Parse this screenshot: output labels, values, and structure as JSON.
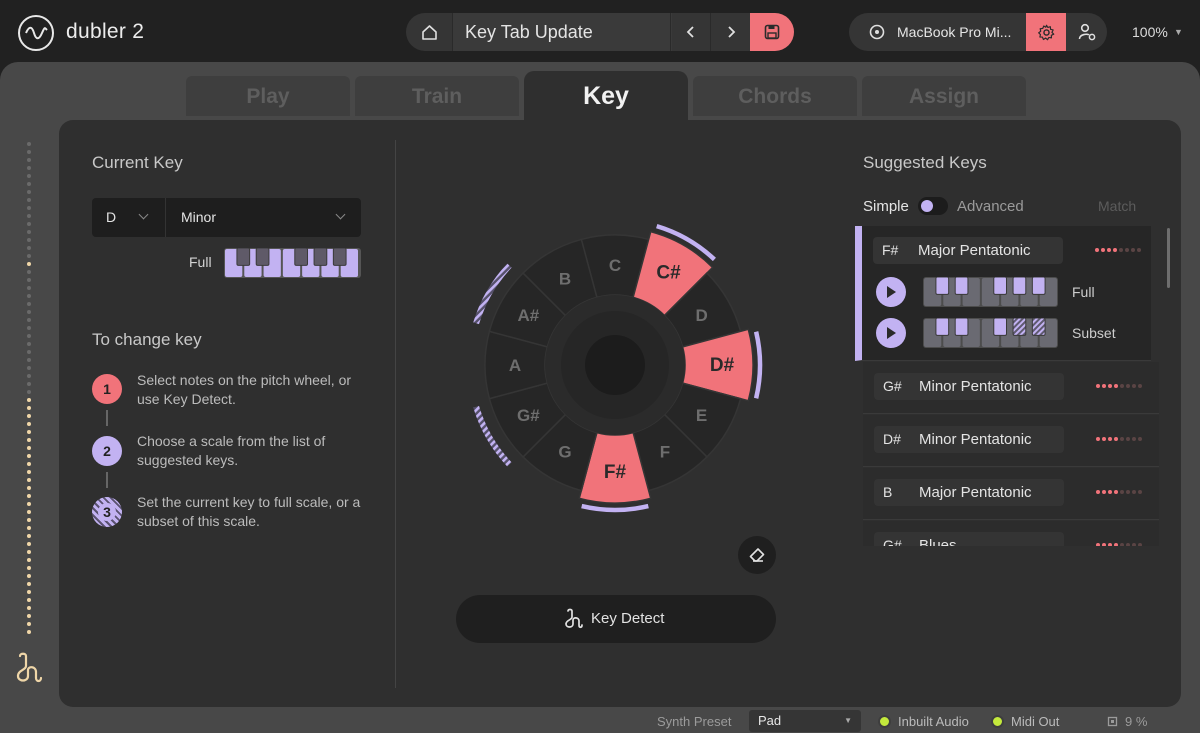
{
  "app": {
    "title": "dubler 2"
  },
  "toolbar": {
    "preset_name": "Key Tab Update",
    "device_name": "MacBook Pro Mi...",
    "zoom": "100%"
  },
  "tabs": [
    {
      "label": "Play"
    },
    {
      "label": "Train"
    },
    {
      "label": "Key",
      "active": true
    },
    {
      "label": "Chords"
    },
    {
      "label": "Assign"
    }
  ],
  "current_key": {
    "title": "Current Key",
    "root": "D",
    "scale": "Minor",
    "range_label": "Full"
  },
  "instructions": {
    "title": "To change key",
    "steps": [
      {
        "num": "1",
        "text": "Select notes on the pitch wheel, or use Key Detect."
      },
      {
        "num": "2",
        "text": "Choose a scale from the list of suggested keys."
      },
      {
        "num": "3",
        "text": "Set the current key to full scale, or a subset of this scale."
      }
    ]
  },
  "pitch_wheel": {
    "notes": [
      "C",
      "C#",
      "D",
      "D#",
      "E",
      "F",
      "F#",
      "G",
      "G#",
      "A",
      "A#",
      "B"
    ],
    "selected": [
      "C#",
      "D#",
      "F#"
    ],
    "arc_solid": [
      "C#",
      "D#",
      "F#"
    ],
    "arc_hatched": [
      "G#",
      "A#"
    ]
  },
  "key_detect": {
    "label": "Key Detect"
  },
  "suggested": {
    "title": "Suggested Keys",
    "mode_simple": "Simple",
    "mode_advanced": "Advanced",
    "match_label": "Match",
    "variant_full": "Full",
    "variant_subset": "Subset",
    "items": [
      {
        "root": "F#",
        "scale": "Major Pentatonic",
        "match": 4
      },
      {
        "root": "G#",
        "scale": "Minor Pentatonic",
        "match": 4
      },
      {
        "root": "D#",
        "scale": "Minor Pentatonic",
        "match": 4
      },
      {
        "root": "B",
        "scale": "Major Pentatonic",
        "match": 4
      },
      {
        "root": "G#",
        "scale": "Blues",
        "match": 4
      }
    ]
  },
  "statusbar": {
    "synth_preset_label": "Synth Preset",
    "synth_preset_value": "Pad",
    "inbuilt_audio": "Inbuilt Audio",
    "midi_out": "Midi Out",
    "cpu": "9 %"
  },
  "colors": {
    "accent_red": "#f1737a",
    "accent_lilac": "#c2b2f2",
    "led_green": "#c4ea3c"
  }
}
